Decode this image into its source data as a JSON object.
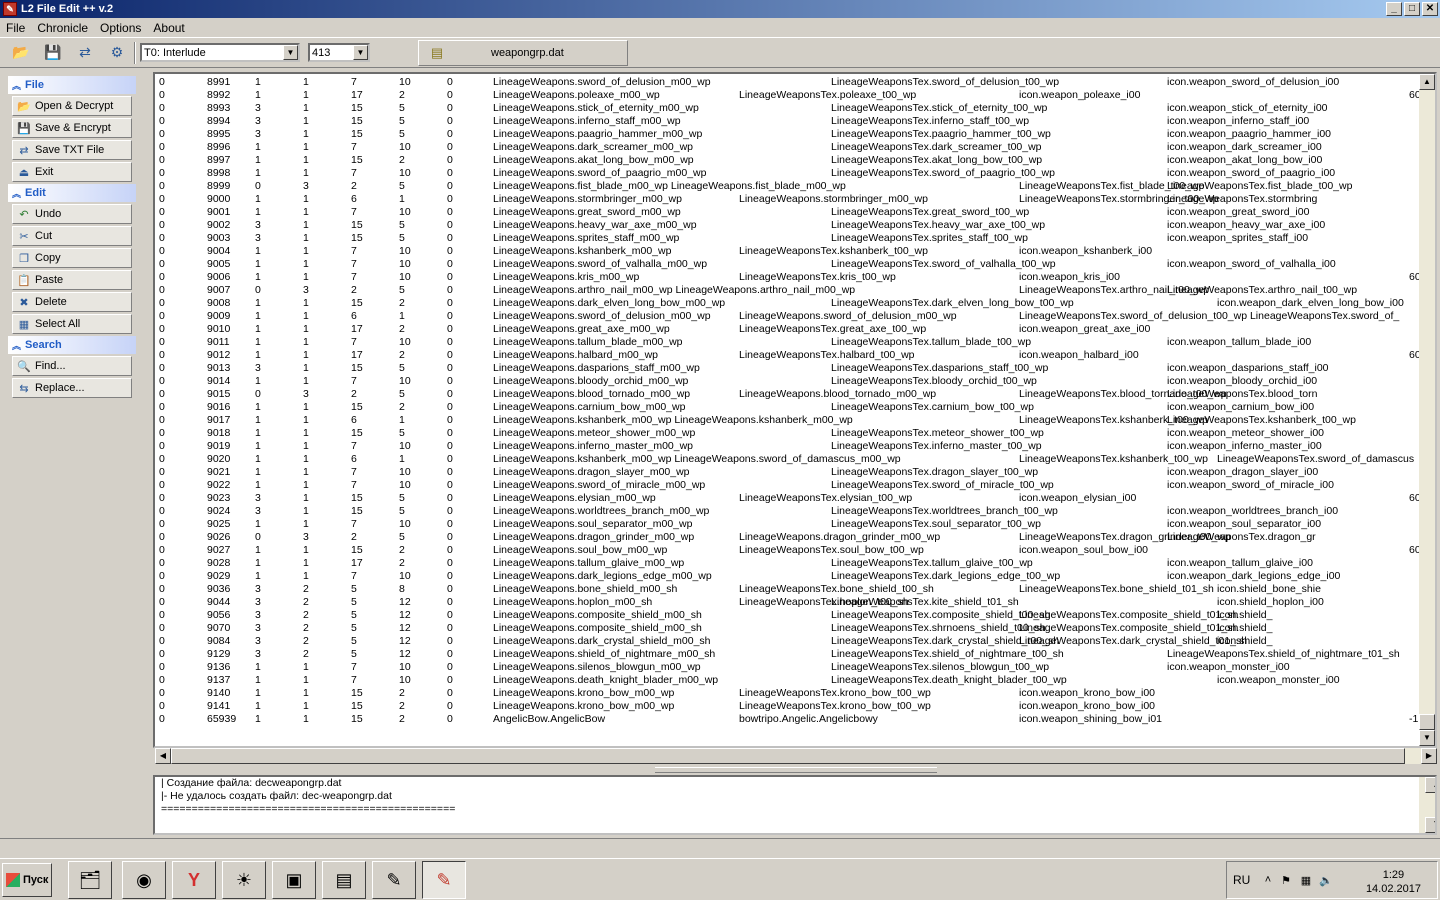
{
  "window": {
    "title": "L2 File Edit ++ v.2",
    "app_icon": "app-icon",
    "min": "_",
    "max": "□",
    "close": "✕"
  },
  "menu": [
    "File",
    "Chronicle",
    "Options",
    "About"
  ],
  "toolbar": {
    "chronicle": "T0: Interlude",
    "version": "413",
    "file_tab": "weapongrp.dat"
  },
  "sidebar": {
    "file_title": "File",
    "edit_title": "Edit",
    "search_title": "Search",
    "file_items": [
      "Open & Decrypt",
      "Save & Encrypt",
      "Save TXT File",
      "Exit"
    ],
    "edit_items": [
      "Undo",
      "Cut",
      "Copy",
      "Paste",
      "Delete",
      "Select All"
    ],
    "search_items": [
      "Find...",
      "Replace..."
    ]
  },
  "rows": [
    [
      "0",
      "8991",
      "1",
      "1",
      "7",
      "10",
      "0",
      "LineageWeapons.sword_of_delusion_m00_wp",
      "",
      "LineageWeaponsTex.sword_of_delusion_t00_wp",
      "",
      "icon.weapon_sword_of_delusion_i00",
      "",
      ""
    ],
    [
      "0",
      "8992",
      "1",
      "1",
      "17",
      "2",
      "0",
      "LineageWeapons.poleaxe_m00_wp",
      "LineageWeaponsTex.poleaxe_t00_wp",
      "",
      "icon.weapon_poleaxe_i00",
      "",
      "",
      "60"
    ],
    [
      "0",
      "8993",
      "3",
      "1",
      "15",
      "5",
      "0",
      "LineageWeapons.stick_of_eternity_m00_wp",
      "",
      "LineageWeaponsTex.stick_of_eternity_t00_wp",
      "",
      "icon.weapon_stick_of_eternity_i00",
      "",
      ""
    ],
    [
      "0",
      "8994",
      "3",
      "1",
      "15",
      "5",
      "0",
      "LineageWeapons.inferno_staff_m00_wp",
      "",
      "LineageWeaponsTex.inferno_staff_t00_wp",
      "",
      "icon.weapon_inferno_staff_i00",
      "",
      ""
    ],
    [
      "0",
      "8995",
      "3",
      "1",
      "15",
      "5",
      "0",
      "LineageWeapons.paagrio_hammer_m00_wp",
      "",
      "LineageWeaponsTex.paagrio_hammer_t00_wp",
      "",
      "icon.weapon_paagrio_hammer_i00",
      "",
      ""
    ],
    [
      "0",
      "8996",
      "1",
      "1",
      "7",
      "10",
      "0",
      "LineageWeapons.dark_screamer_m00_wp",
      "",
      "LineageWeaponsTex.dark_screamer_t00_wp",
      "",
      "icon.weapon_dark_screamer_i00",
      "",
      ""
    ],
    [
      "0",
      "8997",
      "1",
      "1",
      "15",
      "2",
      "0",
      "LineageWeapons.akat_long_bow_m00_wp",
      "",
      "LineageWeaponsTex.akat_long_bow_t00_wp",
      "",
      "icon.weapon_akat_long_bow_i00",
      "",
      ""
    ],
    [
      "0",
      "8998",
      "1",
      "1",
      "7",
      "10",
      "0",
      "LineageWeapons.sword_of_paagrio_m00_wp",
      "",
      "LineageWeaponsTex.sword_of_paagrio_t00_wp",
      "",
      "icon.weapon_sword_of_paagrio_i00",
      "",
      ""
    ],
    [
      "0",
      "8999",
      "0",
      "3",
      "2",
      "5",
      "0",
      "LineageWeapons.fist_blade_m00_wp   LineageWeapons.fist_blade_m00_wp",
      "",
      "",
      "LineageWeaponsTex.fist_blade_t00_wp",
      "LineageWeaponsTex.fist_blade_t00_wp",
      "",
      ""
    ],
    [
      "0",
      "9000",
      "1",
      "1",
      "6",
      "1",
      "0",
      "LineageWeapons.stormbringer_m00_wp",
      "LineageWeapons.stormbringer_m00_wp",
      "",
      "LineageWeaponsTex.stormbringer_t00_wp",
      "LineageWeaponsTex.stormbring",
      "",
      ""
    ],
    [
      "0",
      "9001",
      "1",
      "1",
      "7",
      "10",
      "0",
      "LineageWeapons.great_sword_m00_wp",
      "",
      "LineageWeaponsTex.great_sword_t00_wp",
      "",
      "icon.weapon_great_sword_i00",
      "",
      ""
    ],
    [
      "0",
      "9002",
      "3",
      "1",
      "15",
      "5",
      "0",
      "LineageWeapons.heavy_war_axe_m00_wp",
      "",
      "LineageWeaponsTex.heavy_war_axe_t00_wp",
      "",
      "icon.weapon_heavy_war_axe_i00",
      "",
      ""
    ],
    [
      "0",
      "9003",
      "3",
      "1",
      "15",
      "5",
      "0",
      "LineageWeapons.sprites_staff_m00_wp",
      "",
      "LineageWeaponsTex.sprites_staff_t00_wp",
      "",
      "icon.weapon_sprites_staff_i00",
      "",
      ""
    ],
    [
      "0",
      "9004",
      "1",
      "1",
      "7",
      "10",
      "0",
      "LineageWeapons.kshanberk_m00_wp",
      "LineageWeaponsTex.kshanberk_t00_wp",
      "",
      "icon.weapon_kshanberk_i00",
      "",
      "",
      ""
    ],
    [
      "0",
      "9005",
      "1",
      "1",
      "7",
      "10",
      "0",
      "LineageWeapons.sword_of_valhalla_m00_wp",
      "",
      "LineageWeaponsTex.sword_of_valhalla_t00_wp",
      "",
      "icon.weapon_sword_of_valhalla_i00",
      "",
      ""
    ],
    [
      "0",
      "9006",
      "1",
      "1",
      "7",
      "10",
      "0",
      "LineageWeapons.kris_m00_wp",
      "LineageWeaponsTex.kris_t00_wp",
      "",
      "icon.weapon_kris_i00",
      "",
      "",
      "60"
    ],
    [
      "0",
      "9007",
      "0",
      "3",
      "2",
      "5",
      "0",
      "LineageWeapons.arthro_nail_m00_wp   LineageWeapons.arthro_nail_m00_wp",
      "",
      "",
      "LineageWeaponsTex.arthro_nail_t00_wp",
      "LineageWeaponsTex.arthro_nail_t00_wp",
      "",
      ""
    ],
    [
      "0",
      "9008",
      "1",
      "1",
      "15",
      "2",
      "0",
      "LineageWeapons.dark_elven_long_bow_m00_wp",
      "",
      "LineageWeaponsTex.dark_elven_long_bow_t00_wp",
      "",
      "",
      "icon.weapon_dark_elven_long_bow_i00",
      ""
    ],
    [
      "0",
      "9009",
      "1",
      "1",
      "6",
      "1",
      "0",
      "LineageWeapons.sword_of_delusion_m00_wp",
      "LineageWeapons.sword_of_delusion_m00_wp",
      "",
      "LineageWeaponsTex.sword_of_delusion_t00_wp LineageWeaponsTex.sword_of_",
      "",
      "",
      ""
    ],
    [
      "0",
      "9010",
      "1",
      "1",
      "17",
      "2",
      "0",
      "LineageWeapons.great_axe_m00_wp",
      "LineageWeaponsTex.great_axe_t00_wp",
      "",
      "icon.weapon_great_axe_i00",
      "",
      "",
      ""
    ],
    [
      "0",
      "9011",
      "1",
      "1",
      "7",
      "10",
      "0",
      "LineageWeapons.tallum_blade_m00_wp",
      "",
      "LineageWeaponsTex.tallum_blade_t00_wp",
      "",
      "icon.weapon_tallum_blade_i00",
      "",
      ""
    ],
    [
      "0",
      "9012",
      "1",
      "1",
      "17",
      "2",
      "0",
      "LineageWeapons.halbard_m00_wp",
      "LineageWeaponsTex.halbard_t00_wp",
      "",
      "icon.weapon_halbard_i00",
      "",
      "",
      "60"
    ],
    [
      "0",
      "9013",
      "3",
      "1",
      "15",
      "5",
      "0",
      "LineageWeapons.dasparions_staff_m00_wp",
      "",
      "LineageWeaponsTex.dasparions_staff_t00_wp",
      "",
      "icon.weapon_dasparions_staff_i00",
      "",
      ""
    ],
    [
      "0",
      "9014",
      "1",
      "1",
      "7",
      "10",
      "0",
      "LineageWeapons.bloody_orchid_m00_wp",
      "",
      "LineageWeaponsTex.bloody_orchid_t00_wp",
      "",
      "icon.weapon_bloody_orchid_i00",
      "",
      ""
    ],
    [
      "0",
      "9015",
      "0",
      "3",
      "2",
      "5",
      "0",
      "LineageWeapons.blood_tornado_m00_wp",
      "LineageWeapons.blood_tornado_m00_wp",
      "",
      "LineageWeaponsTex.blood_tornado_t00_wp",
      "LineageWeaponsTex.blood_torn",
      "",
      ""
    ],
    [
      "0",
      "9016",
      "1",
      "1",
      "15",
      "2",
      "0",
      "LineageWeapons.carnium_bow_m00_wp",
      "",
      "LineageWeaponsTex.carnium_bow_t00_wp",
      "",
      "icon.weapon_carnium_bow_i00",
      "",
      ""
    ],
    [
      "0",
      "9017",
      "1",
      "1",
      "6",
      "1",
      "0",
      "LineageWeapons.kshanberk_m00_wp   LineageWeapons.kshanberk_m00_wp",
      "",
      "",
      "LineageWeaponsTex.kshanberk_t00_wp",
      "LineageWeaponsTex.kshanberk_t00_wp",
      "",
      ""
    ],
    [
      "0",
      "9018",
      "1",
      "1",
      "15",
      "5",
      "0",
      "LineageWeapons.meteor_shower_m00_wp",
      "",
      "LineageWeaponsTex.meteor_shower_t00_wp",
      "",
      "icon.weapon_meteor_shower_i00",
      "",
      ""
    ],
    [
      "0",
      "9019",
      "1",
      "1",
      "7",
      "10",
      "0",
      "LineageWeapons.inferno_master_m00_wp",
      "",
      "LineageWeaponsTex.inferno_master_t00_wp",
      "",
      "icon.weapon_inferno_master_i00",
      "",
      ""
    ],
    [
      "0",
      "9020",
      "1",
      "1",
      "6",
      "1",
      "0",
      "LineageWeapons.kshanberk_m00_wp   LineageWeapons.sword_of_damascus_m00_wp",
      "",
      "",
      "LineageWeaponsTex.kshanberk_t00_wp",
      "",
      "LineageWeaponsTex.sword_of_damascus",
      ""
    ],
    [
      "0",
      "9021",
      "1",
      "1",
      "7",
      "10",
      "0",
      "LineageWeapons.dragon_slayer_m00_wp",
      "",
      "LineageWeaponsTex.dragon_slayer_t00_wp",
      "",
      "icon.weapon_dragon_slayer_i00",
      "",
      ""
    ],
    [
      "0",
      "9022",
      "1",
      "1",
      "7",
      "10",
      "0",
      "LineageWeapons.sword_of_miracle_m00_wp",
      "",
      "LineageWeaponsTex.sword_of_miracle_t00_wp",
      "",
      "icon.weapon_sword_of_miracle_i00",
      "",
      ""
    ],
    [
      "0",
      "9023",
      "3",
      "1",
      "15",
      "5",
      "0",
      "LineageWeapons.elysian_m00_wp",
      "LineageWeaponsTex.elysian_t00_wp",
      "",
      "icon.weapon_elysian_i00",
      "",
      "",
      "60"
    ],
    [
      "0",
      "9024",
      "3",
      "1",
      "15",
      "5",
      "0",
      "LineageWeapons.worldtrees_branch_m00_wp",
      "",
      "LineageWeaponsTex.worldtrees_branch_t00_wp",
      "",
      "icon.weapon_worldtrees_branch_i00",
      "",
      ""
    ],
    [
      "0",
      "9025",
      "1",
      "1",
      "7",
      "10",
      "0",
      "LineageWeapons.soul_separator_m00_wp",
      "",
      "LineageWeaponsTex.soul_separator_t00_wp",
      "",
      "icon.weapon_soul_separator_i00",
      "",
      ""
    ],
    [
      "0",
      "9026",
      "0",
      "3",
      "2",
      "5",
      "0",
      "LineageWeapons.dragon_grinder_m00_wp",
      "LineageWeapons.dragon_grinder_m00_wp",
      "",
      "LineageWeaponsTex.dragon_grinder_t00_wp",
      "LineageWeaponsTex.dragon_gr",
      "",
      ""
    ],
    [
      "0",
      "9027",
      "1",
      "1",
      "15",
      "2",
      "0",
      "LineageWeapons.soul_bow_m00_wp",
      "LineageWeaponsTex.soul_bow_t00_wp",
      "",
      "icon.weapon_soul_bow_i00",
      "",
      "",
      "60"
    ],
    [
      "0",
      "9028",
      "1",
      "1",
      "17",
      "2",
      "0",
      "LineageWeapons.tallum_glaive_m00_wp",
      "",
      "LineageWeaponsTex.tallum_glaive_t00_wp",
      "",
      "icon.weapon_tallum_glaive_i00",
      "",
      ""
    ],
    [
      "0",
      "9029",
      "1",
      "1",
      "7",
      "10",
      "0",
      "LineageWeapons.dark_legions_edge_m00_wp",
      "",
      "LineageWeaponsTex.dark_legions_edge_t00_wp",
      "",
      "icon.weapon_dark_legions_edge_i00",
      "",
      ""
    ],
    [
      "0",
      "9036",
      "3",
      "2",
      "5",
      "8",
      "0",
      "LineageWeapons.bone_shield_m00_sh",
      "LineageWeaponsTex.bone_shield_t00_sh",
      "",
      "LineageWeaponsTex.bone_shield_t01_sh",
      "",
      "icon.shield_bone_shie",
      ""
    ],
    [
      "0",
      "9044",
      "3",
      "2",
      "5",
      "12",
      "0",
      "LineageWeapons.hoplon_m00_sh",
      "LineageWeaponsTex.hoplon_t00_sh",
      "LineageWeaponsTex.kite_shield_t01_sh",
      "",
      "",
      "icon.shield_hoplon_i00",
      ""
    ],
    [
      "0",
      "9056",
      "3",
      "2",
      "5",
      "12",
      "0",
      "LineageWeapons.composite_shield_m00_sh",
      "",
      "LineageWeaponsTex.composite_shield_t00_sh",
      "LineageWeaponsTex.composite_shield_t01_sh",
      "",
      "icon.shield_",
      ""
    ],
    [
      "0",
      "9070",
      "3",
      "2",
      "5",
      "12",
      "0",
      "LineageWeapons.composite_shield_m00_sh",
      "",
      "LineageWeaponsTex.shrnoens_shield_t00_sh",
      "LineageWeaponsTex.composite_shield_t01_sh",
      "",
      "icon.shield_",
      ""
    ],
    [
      "0",
      "9084",
      "3",
      "2",
      "5",
      "12",
      "0",
      "LineageWeapons.dark_crystal_shield_m00_sh",
      "",
      "LineageWeaponsTex.dark_crystal_shield_t00_sh",
      "LineageWeaponsTex.dark_crystal_shield_t01_sh",
      "",
      "icon.shield_",
      ""
    ],
    [
      "0",
      "9129",
      "3",
      "2",
      "5",
      "12",
      "0",
      "LineageWeapons.shield_of_nightmare_m00_sh",
      "",
      "LineageWeaponsTex.shield_of_nightmare_t00_sh",
      "",
      "LineageWeaponsTex.shield_of_nightmare_t01_sh",
      "",
      ""
    ],
    [
      "0",
      "9136",
      "1",
      "1",
      "7",
      "10",
      "0",
      "LineageWeapons.silenos_blowgun_m00_wp",
      "",
      "LineageWeaponsTex.silenos_blowgun_t00_wp",
      "",
      "icon.weapon_monster_i00",
      "",
      ""
    ],
    [
      "0",
      "9137",
      "1",
      "1",
      "7",
      "10",
      "0",
      "LineageWeapons.death_knight_blader_m00_wp",
      "",
      "LineageWeaponsTex.death_knight_blader_t00_wp",
      "",
      "",
      "icon.weapon_monster_i00",
      ""
    ],
    [
      "0",
      "9140",
      "1",
      "1",
      "15",
      "2",
      "0",
      "LineageWeapons.krono_bow_m00_wp",
      "LineageWeaponsTex.krono_bow_t00_wp",
      "",
      "icon.weapon_krono_bow_i00",
      "",
      "",
      ""
    ],
    [
      "0",
      "9141",
      "1",
      "1",
      "15",
      "2",
      "0",
      "LineageWeapons.krono_bow_m00_wp",
      "LineageWeaponsTex.krono_bow_t00_wp",
      "",
      "icon.weapon_krono_bow_i00",
      "",
      "",
      ""
    ],
    [
      "0",
      "65939",
      "1",
      "1",
      "15",
      "2",
      "0",
      "AngelicBow.AngelicBow",
      "bowtripo.Angelic.Angelicbowy",
      "",
      "icon.weapon_shining_bow_i01",
      "",
      "",
      "-1"
    ]
  ],
  "log": [
    "|  Создание файла: decweapongrp.dat",
    "|-  Не удалось создать файл: dec-weapongrp.dat",
    "================================================"
  ],
  "taskbar": {
    "start": "Пуск",
    "lang": "RU",
    "time": "1:29",
    "date": "14.02.2017"
  }
}
